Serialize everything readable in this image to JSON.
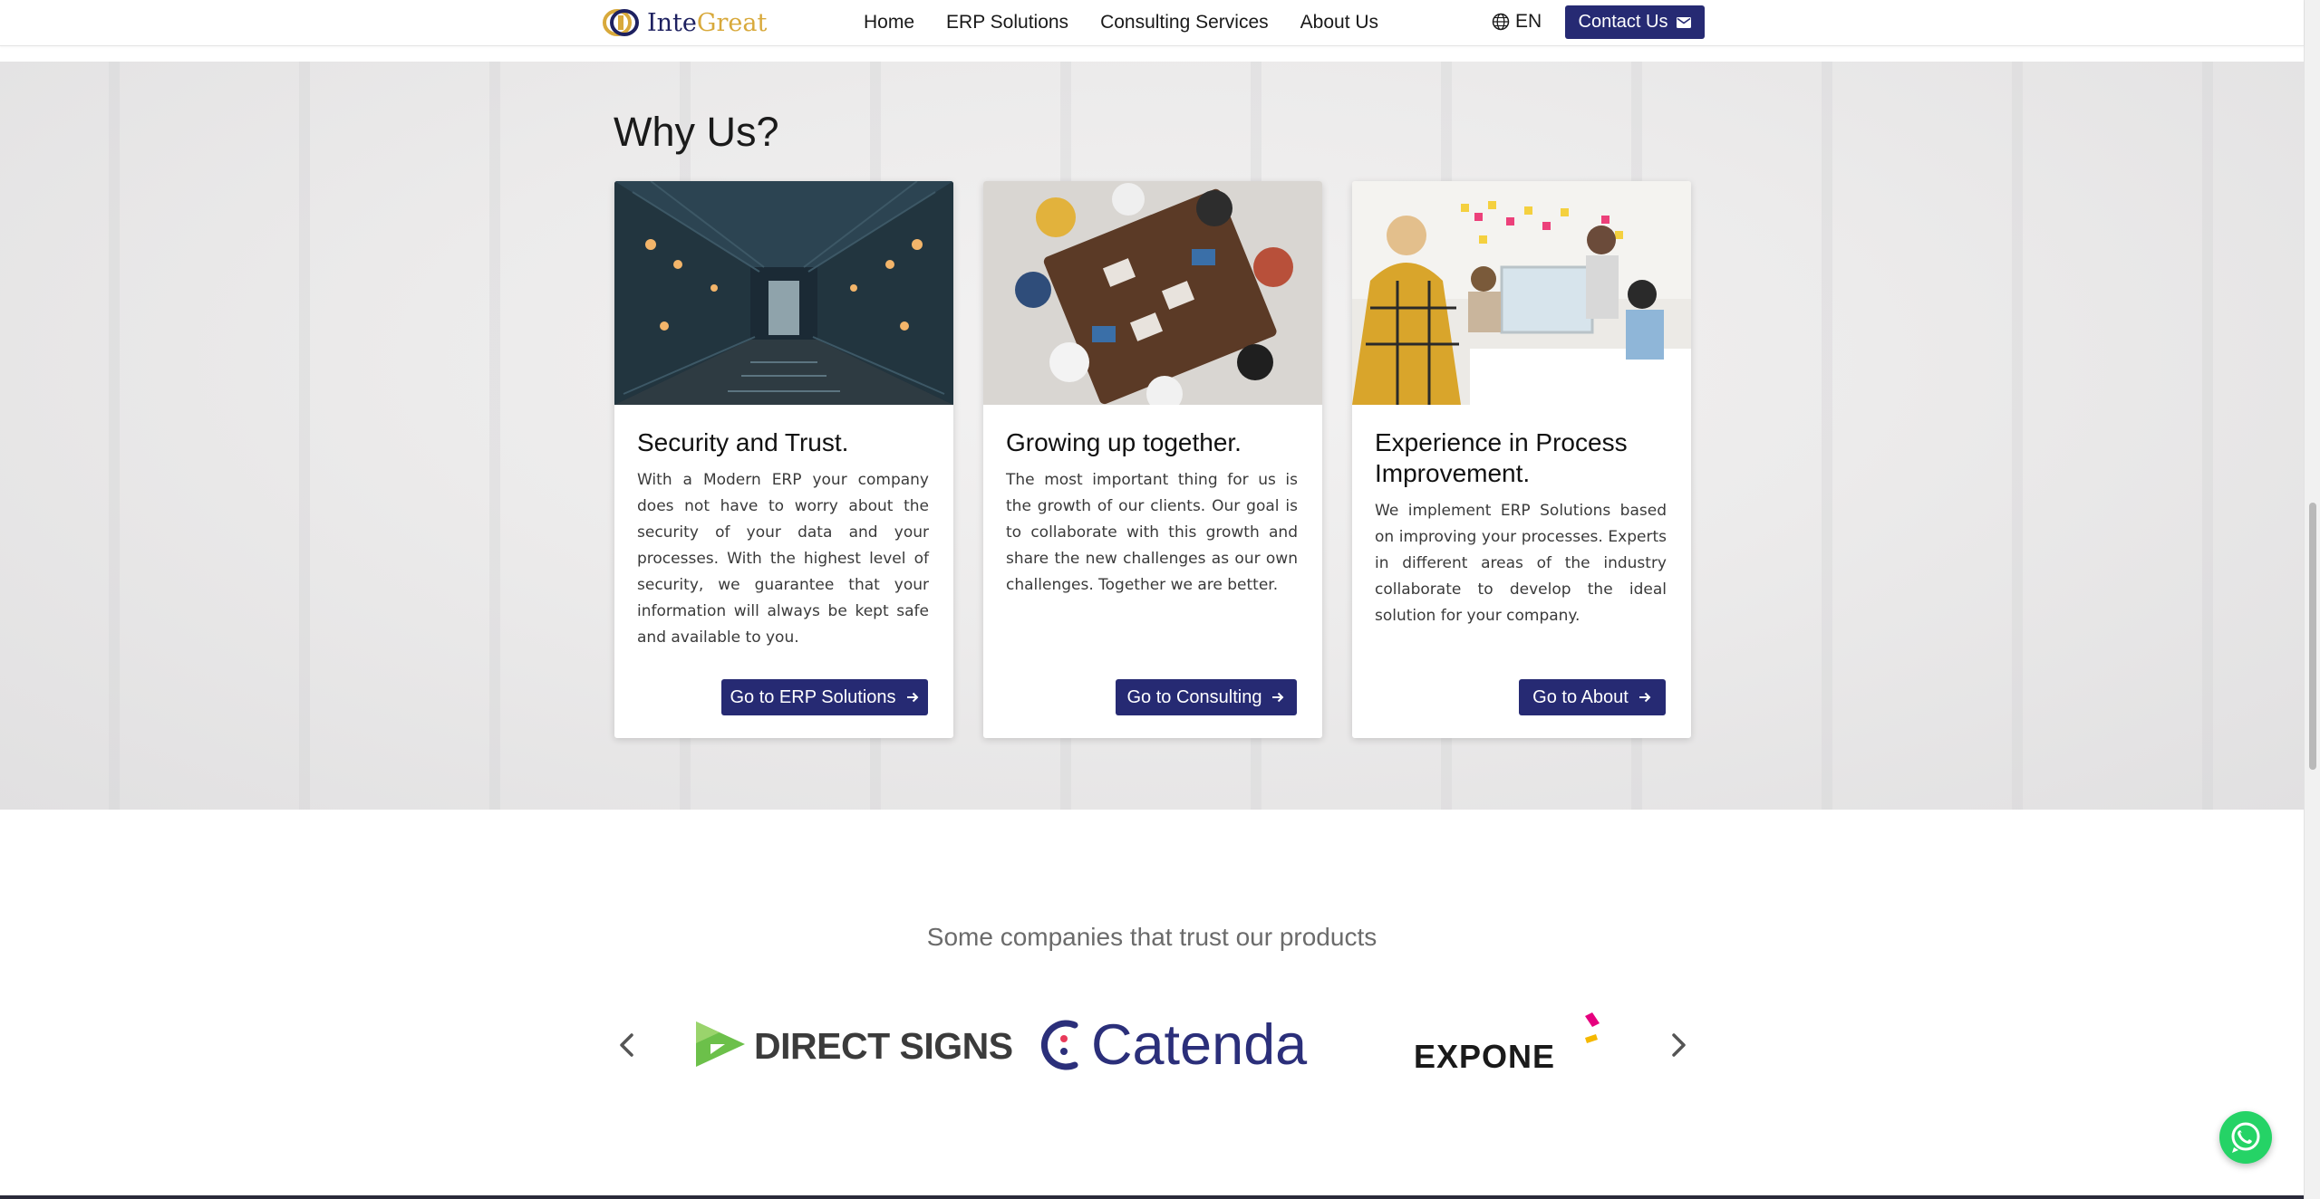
{
  "header": {
    "brand_prefix": "Inte",
    "brand_suffix": "Great",
    "nav": [
      {
        "label": "Home"
      },
      {
        "label": "ERP Solutions"
      },
      {
        "label": "Consulting Services"
      },
      {
        "label": "About Us"
      }
    ],
    "language": "EN",
    "contact_label": "Contact Us"
  },
  "why_us": {
    "title": "Why Us?",
    "cards": [
      {
        "title": "Security and Trust.",
        "text": "With a Modern ERP your company does not have to worry about the security of your data and your processes. With the highest level of security, we guarantee that your information will always be kept safe and available to you.",
        "button": "Go to ERP Solutions"
      },
      {
        "title": "Growing up together.",
        "text": "The most important thing for us is the growth of our clients. Our goal is to collaborate with this growth and share the new challenges as our own challenges. Together we are better.",
        "button": "Go to Consulting"
      },
      {
        "title": "Experience in Process Improvement.",
        "text": "We implement ERP Solutions based on improving your processes. Experts in different areas of the industry collaborate to develop the ideal solution for your company.",
        "button": "Go to About"
      }
    ]
  },
  "companies": {
    "title": "Some companies that trust our products",
    "logos": [
      "DIRECT SIGNS",
      "Catenda",
      "EXPONE"
    ]
  },
  "colors": {
    "primary": "#262a73",
    "brand_gold": "#d8a93b",
    "whatsapp": "#25d366",
    "catenda_blue": "#2b2f7a",
    "directsigns_green": "#6cc04a",
    "expone_pink": "#e6007e"
  },
  "icons": [
    "globe-icon",
    "mail-icon",
    "arrow-right-icon",
    "chevron-left-icon",
    "chevron-right-icon",
    "whatsapp-icon"
  ]
}
